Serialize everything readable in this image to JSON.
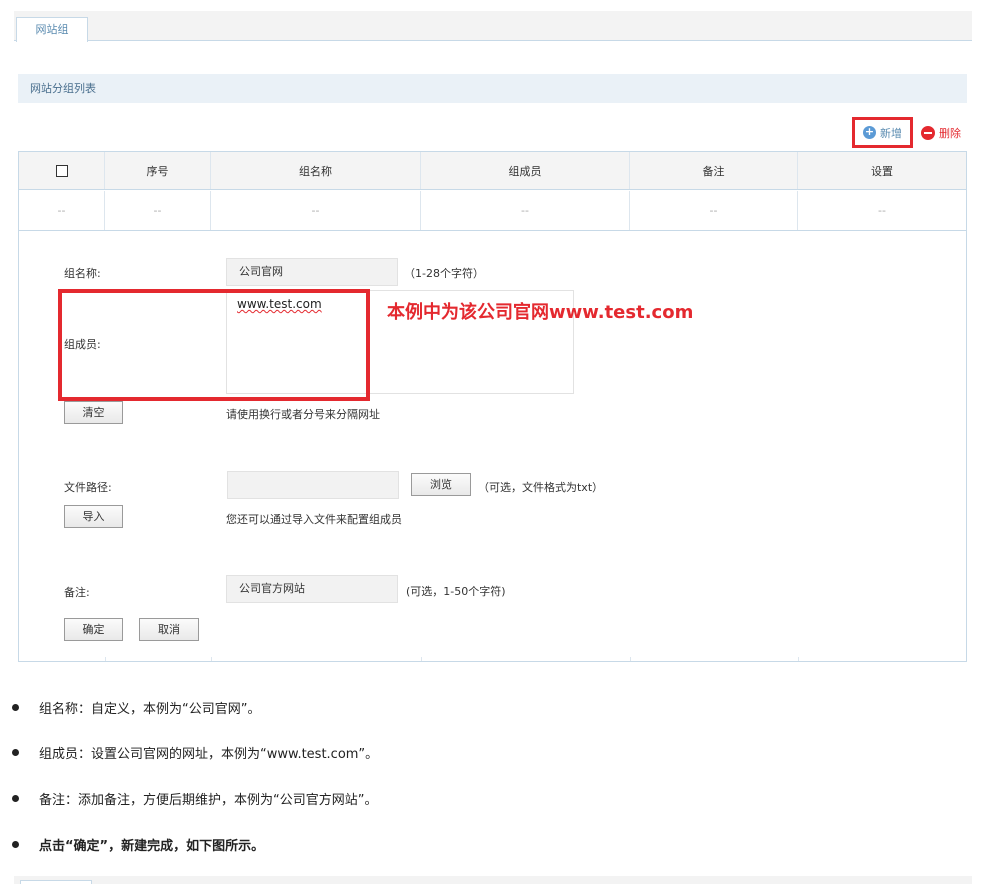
{
  "tabs": {
    "website_group": "网站组"
  },
  "section": {
    "title": "网站分组列表"
  },
  "toolbar": {
    "add_label": "新增",
    "delete_label": "删除"
  },
  "table": {
    "columns": [
      "序号",
      "组名称",
      "组成员",
      "备注",
      "设置"
    ],
    "row": [
      "--",
      "--",
      "--",
      "--",
      "--",
      "--"
    ]
  },
  "form": {
    "group_name_label": "组名称:",
    "group_name_value": "公司官网",
    "group_name_hint": "（1-28个字符）",
    "members_label": "组成员:",
    "members_value": "www.test.com",
    "clear_button": "清空",
    "members_hint": "请使用换行或者分号来分隔网址",
    "file_path_label": "文件路径:",
    "browse_button": "浏览",
    "file_hint": "（可选，文件格式为txt）",
    "import_button": "导入",
    "import_hint": "您还可以通过导入文件来配置组成员",
    "note_label": "备注:",
    "note_value": "公司官方网站",
    "note_hint": "(可选，1-50个字符)",
    "ok_button": "确定",
    "cancel_button": "取消"
  },
  "annotation": {
    "text": "本例中为该公司官网www.test.com"
  },
  "bullets": [
    "组名称：自定义，本例为“公司官网”。",
    "组成员：设置公司官网的网址，本例为“www.test.com”。",
    "备注：添加备注，方便后期维护，本例为“公司官方网站”。",
    "点击“确定”，新建完成，如下图所示。"
  ],
  "colors": {
    "accent_red": "#e4292f",
    "link_blue": "#5a8bb0",
    "header_bg": "#eaf1f7"
  }
}
